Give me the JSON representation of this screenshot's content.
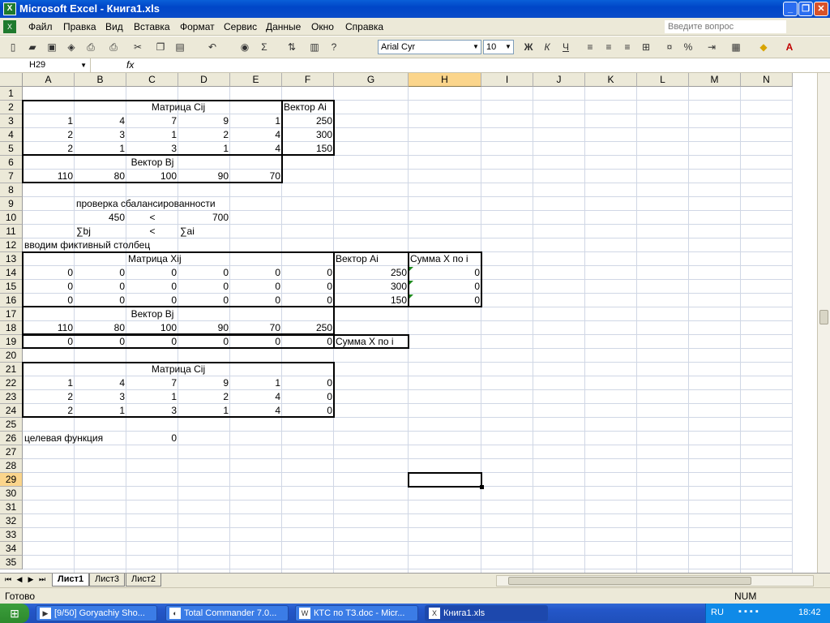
{
  "window": {
    "title": "Microsoft Excel - Книга1.xls",
    "app_icon": "excel-icon",
    "controls": [
      "_",
      "❐",
      "✕"
    ]
  },
  "menu": {
    "items": [
      "Файл",
      "Правка",
      "Вид",
      "Вставка",
      "Формат",
      "Сервис",
      "Данные",
      "Окно",
      "Справка"
    ],
    "ask_placeholder": "Введите вопрос"
  },
  "toolbar": {
    "font_name": "Arial Cyr",
    "font_size": "10",
    "bold": "Ж",
    "italic": "К",
    "underline": "Ч",
    "percent": "%",
    "sum": "Σ"
  },
  "formula_bar": {
    "name_box": "H29",
    "fx": "fx",
    "value": ""
  },
  "columns": [
    "A",
    "B",
    "C",
    "D",
    "E",
    "F",
    "G",
    "H",
    "I",
    "J",
    "K",
    "L",
    "M",
    "N"
  ],
  "rows": [
    "1",
    "2",
    "3",
    "4",
    "5",
    "6",
    "7",
    "8",
    "9",
    "10",
    "11",
    "12",
    "13",
    "14",
    "15",
    "16",
    "17",
    "18",
    "19",
    "20",
    "21",
    "22",
    "23",
    "24",
    "25",
    "26",
    "27",
    "28",
    "29",
    "30",
    "31",
    "32",
    "33",
    "34",
    "35"
  ],
  "selected": {
    "col": "H",
    "row": "29"
  },
  "cells": [
    {
      "col": "B",
      "row": 2,
      "text": "Матрица Cij",
      "align": "c",
      "span": 4
    },
    {
      "col": "F",
      "row": 2,
      "text": "Вектор Ai",
      "align": "l"
    },
    {
      "col": "A",
      "row": 3,
      "text": "1",
      "align": "r"
    },
    {
      "col": "B",
      "row": 3,
      "text": "4",
      "align": "r"
    },
    {
      "col": "C",
      "row": 3,
      "text": "7",
      "align": "r"
    },
    {
      "col": "D",
      "row": 3,
      "text": "9",
      "align": "r"
    },
    {
      "col": "E",
      "row": 3,
      "text": "1",
      "align": "r"
    },
    {
      "col": "F",
      "row": 3,
      "text": "250",
      "align": "r"
    },
    {
      "col": "A",
      "row": 4,
      "text": "2",
      "align": "r"
    },
    {
      "col": "B",
      "row": 4,
      "text": "3",
      "align": "r"
    },
    {
      "col": "C",
      "row": 4,
      "text": "1",
      "align": "r"
    },
    {
      "col": "D",
      "row": 4,
      "text": "2",
      "align": "r"
    },
    {
      "col": "E",
      "row": 4,
      "text": "4",
      "align": "r"
    },
    {
      "col": "F",
      "row": 4,
      "text": "300",
      "align": "r"
    },
    {
      "col": "A",
      "row": 5,
      "text": "2",
      "align": "r"
    },
    {
      "col": "B",
      "row": 5,
      "text": "1",
      "align": "r"
    },
    {
      "col": "C",
      "row": 5,
      "text": "3",
      "align": "r"
    },
    {
      "col": "D",
      "row": 5,
      "text": "1",
      "align": "r"
    },
    {
      "col": "E",
      "row": 5,
      "text": "4",
      "align": "r"
    },
    {
      "col": "F",
      "row": 5,
      "text": "150",
      "align": "r"
    },
    {
      "col": "C",
      "row": 6,
      "text": "Вектор Bj",
      "align": "c"
    },
    {
      "col": "A",
      "row": 7,
      "text": "110",
      "align": "r"
    },
    {
      "col": "B",
      "row": 7,
      "text": "80",
      "align": "r"
    },
    {
      "col": "C",
      "row": 7,
      "text": "100",
      "align": "r"
    },
    {
      "col": "D",
      "row": 7,
      "text": "90",
      "align": "r"
    },
    {
      "col": "E",
      "row": 7,
      "text": "70",
      "align": "r"
    },
    {
      "col": "B",
      "row": 9,
      "text": "проверка сбалансированности",
      "align": "l"
    },
    {
      "col": "B",
      "row": 10,
      "text": "450",
      "align": "r"
    },
    {
      "col": "C",
      "row": 10,
      "text": "<",
      "align": "c"
    },
    {
      "col": "D",
      "row": 10,
      "text": "700",
      "align": "r"
    },
    {
      "col": "B",
      "row": 11,
      "text": "∑bj",
      "align": "l"
    },
    {
      "col": "C",
      "row": 11,
      "text": "<",
      "align": "c"
    },
    {
      "col": "D",
      "row": 11,
      "text": "∑ai",
      "align": "l"
    },
    {
      "col": "A",
      "row": 12,
      "text": "вводим фиктивный столбец",
      "align": "l"
    },
    {
      "col": "C",
      "row": 13,
      "text": "Матрица Xij",
      "align": "c"
    },
    {
      "col": "G",
      "row": 13,
      "text": "Вектор Ai",
      "align": "l"
    },
    {
      "col": "H",
      "row": 13,
      "text": "Сумма Х по i",
      "align": "l"
    },
    {
      "col": "A",
      "row": 14,
      "text": "0",
      "align": "r"
    },
    {
      "col": "B",
      "row": 14,
      "text": "0",
      "align": "r"
    },
    {
      "col": "C",
      "row": 14,
      "text": "0",
      "align": "r"
    },
    {
      "col": "D",
      "row": 14,
      "text": "0",
      "align": "r"
    },
    {
      "col": "E",
      "row": 14,
      "text": "0",
      "align": "r"
    },
    {
      "col": "F",
      "row": 14,
      "text": "0",
      "align": "r"
    },
    {
      "col": "G",
      "row": 14,
      "text": "250",
      "align": "r"
    },
    {
      "col": "H",
      "row": 14,
      "text": "0",
      "align": "r"
    },
    {
      "col": "A",
      "row": 15,
      "text": "0",
      "align": "r"
    },
    {
      "col": "B",
      "row": 15,
      "text": "0",
      "align": "r"
    },
    {
      "col": "C",
      "row": 15,
      "text": "0",
      "align": "r"
    },
    {
      "col": "D",
      "row": 15,
      "text": "0",
      "align": "r"
    },
    {
      "col": "E",
      "row": 15,
      "text": "0",
      "align": "r"
    },
    {
      "col": "F",
      "row": 15,
      "text": "0",
      "align": "r"
    },
    {
      "col": "G",
      "row": 15,
      "text": "300",
      "align": "r"
    },
    {
      "col": "H",
      "row": 15,
      "text": "0",
      "align": "r"
    },
    {
      "col": "A",
      "row": 16,
      "text": "0",
      "align": "r"
    },
    {
      "col": "B",
      "row": 16,
      "text": "0",
      "align": "r"
    },
    {
      "col": "C",
      "row": 16,
      "text": "0",
      "align": "r"
    },
    {
      "col": "D",
      "row": 16,
      "text": "0",
      "align": "r"
    },
    {
      "col": "E",
      "row": 16,
      "text": "0",
      "align": "r"
    },
    {
      "col": "F",
      "row": 16,
      "text": "0",
      "align": "r"
    },
    {
      "col": "G",
      "row": 16,
      "text": "150",
      "align": "r"
    },
    {
      "col": "H",
      "row": 16,
      "text": "0",
      "align": "r"
    },
    {
      "col": "C",
      "row": 17,
      "text": "Вектор Bj",
      "align": "c"
    },
    {
      "col": "A",
      "row": 18,
      "text": "110",
      "align": "r"
    },
    {
      "col": "B",
      "row": 18,
      "text": "80",
      "align": "r"
    },
    {
      "col": "C",
      "row": 18,
      "text": "100",
      "align": "r"
    },
    {
      "col": "D",
      "row": 18,
      "text": "90",
      "align": "r"
    },
    {
      "col": "E",
      "row": 18,
      "text": "70",
      "align": "r"
    },
    {
      "col": "F",
      "row": 18,
      "text": "250",
      "align": "r"
    },
    {
      "col": "A",
      "row": 19,
      "text": "0",
      "align": "r"
    },
    {
      "col": "B",
      "row": 19,
      "text": "0",
      "align": "r"
    },
    {
      "col": "C",
      "row": 19,
      "text": "0",
      "align": "r"
    },
    {
      "col": "D",
      "row": 19,
      "text": "0",
      "align": "r"
    },
    {
      "col": "E",
      "row": 19,
      "text": "0",
      "align": "r"
    },
    {
      "col": "F",
      "row": 19,
      "text": "0",
      "align": "r"
    },
    {
      "col": "G",
      "row": 19,
      "text": "Сумма Х по  i",
      "align": "l"
    },
    {
      "col": "B",
      "row": 21,
      "text": "Матрица Cij",
      "align": "c",
      "span": 4
    },
    {
      "col": "A",
      "row": 22,
      "text": "1",
      "align": "r"
    },
    {
      "col": "B",
      "row": 22,
      "text": "4",
      "align": "r"
    },
    {
      "col": "C",
      "row": 22,
      "text": "7",
      "align": "r"
    },
    {
      "col": "D",
      "row": 22,
      "text": "9",
      "align": "r"
    },
    {
      "col": "E",
      "row": 22,
      "text": "1",
      "align": "r"
    },
    {
      "col": "F",
      "row": 22,
      "text": "0",
      "align": "r"
    },
    {
      "col": "A",
      "row": 23,
      "text": "2",
      "align": "r"
    },
    {
      "col": "B",
      "row": 23,
      "text": "3",
      "align": "r"
    },
    {
      "col": "C",
      "row": 23,
      "text": "1",
      "align": "r"
    },
    {
      "col": "D",
      "row": 23,
      "text": "2",
      "align": "r"
    },
    {
      "col": "E",
      "row": 23,
      "text": "4",
      "align": "r"
    },
    {
      "col": "F",
      "row": 23,
      "text": "0",
      "align": "r"
    },
    {
      "col": "A",
      "row": 24,
      "text": "2",
      "align": "r"
    },
    {
      "col": "B",
      "row": 24,
      "text": "1",
      "align": "r"
    },
    {
      "col": "C",
      "row": 24,
      "text": "3",
      "align": "r"
    },
    {
      "col": "D",
      "row": 24,
      "text": "1",
      "align": "r"
    },
    {
      "col": "E",
      "row": 24,
      "text": "4",
      "align": "r"
    },
    {
      "col": "F",
      "row": 24,
      "text": "0",
      "align": "r"
    },
    {
      "col": "A",
      "row": 26,
      "text": "целевая функция",
      "align": "l"
    },
    {
      "col": "C",
      "row": 26,
      "text": "0",
      "align": "r"
    }
  ],
  "sheets": {
    "tabs": [
      "Лист1",
      "Лист3",
      "Лист2"
    ],
    "active": "Лист1"
  },
  "status": {
    "left": "Готово",
    "num": "NUM"
  },
  "taskbar": {
    "start_icon": "windows-logo-icon",
    "tasks": [
      {
        "label": "[9/50] Goryachiy Sho...",
        "icon": "media-player-icon"
      },
      {
        "label": "Total Commander 7.0...",
        "icon": "total-commander-icon"
      },
      {
        "label": "КТС по ТЗ.doc - Micr...",
        "icon": "word-icon"
      },
      {
        "label": "Книга1.xls",
        "icon": "excel-icon",
        "active": true
      }
    ],
    "lang": "RU",
    "clock": "18:42"
  }
}
